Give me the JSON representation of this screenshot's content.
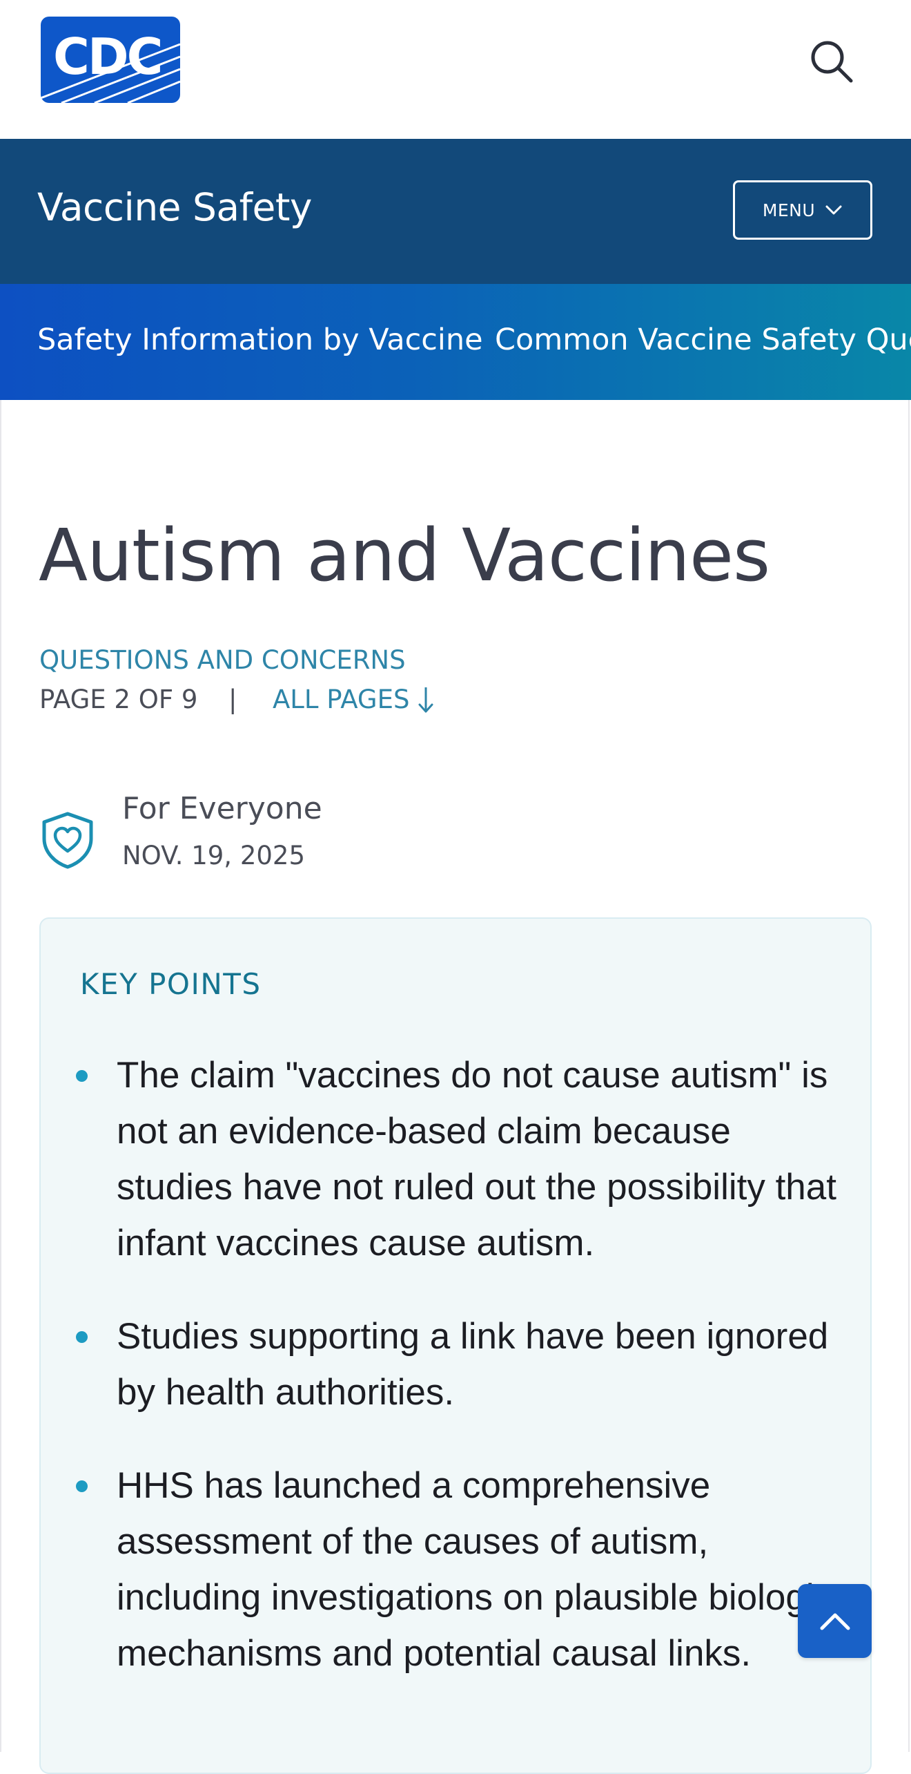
{
  "header": {
    "logo_text": "CDC",
    "logo_color": "#0e57c9",
    "search_icon": "search-icon"
  },
  "site_bar": {
    "title": "Vaccine Safety",
    "menu_label": "MENU",
    "background": "#12497a"
  },
  "sub_nav": {
    "items": [
      {
        "label": "Safety Information by Vaccine"
      },
      {
        "label": "Common Vaccine Safety Ques"
      }
    ]
  },
  "article": {
    "title": "Autism and Vaccines",
    "series_link": "QUESTIONS AND CONCERNS",
    "page_indicator": "PAGE 2 OF 9",
    "separator": "|",
    "all_pages_label": "ALL PAGES",
    "audience": "For Everyone",
    "date": "NOV. 19, 2025",
    "audience_icon": "heart-shield-icon"
  },
  "key_points": {
    "heading": "KEY POINTS",
    "items": [
      "The claim \"vaccines do not cause autism\" is not an evidence-based claim because studies have not ruled out the possibility that infant vaccines cause autism.",
      "Studies supporting a link have been ignored by health authorities.",
      "HHS has launched a comprehensive assessment of the causes of autism, including investigations on plausible biologic mechanisms and potential causal links."
    ]
  },
  "back_to_top_icon": "chevron-up-icon",
  "colors": {
    "accent": "#2e85a8",
    "bullet": "#1d9bc2",
    "key_heading": "#157490",
    "back_to_top": "#1961c7"
  }
}
